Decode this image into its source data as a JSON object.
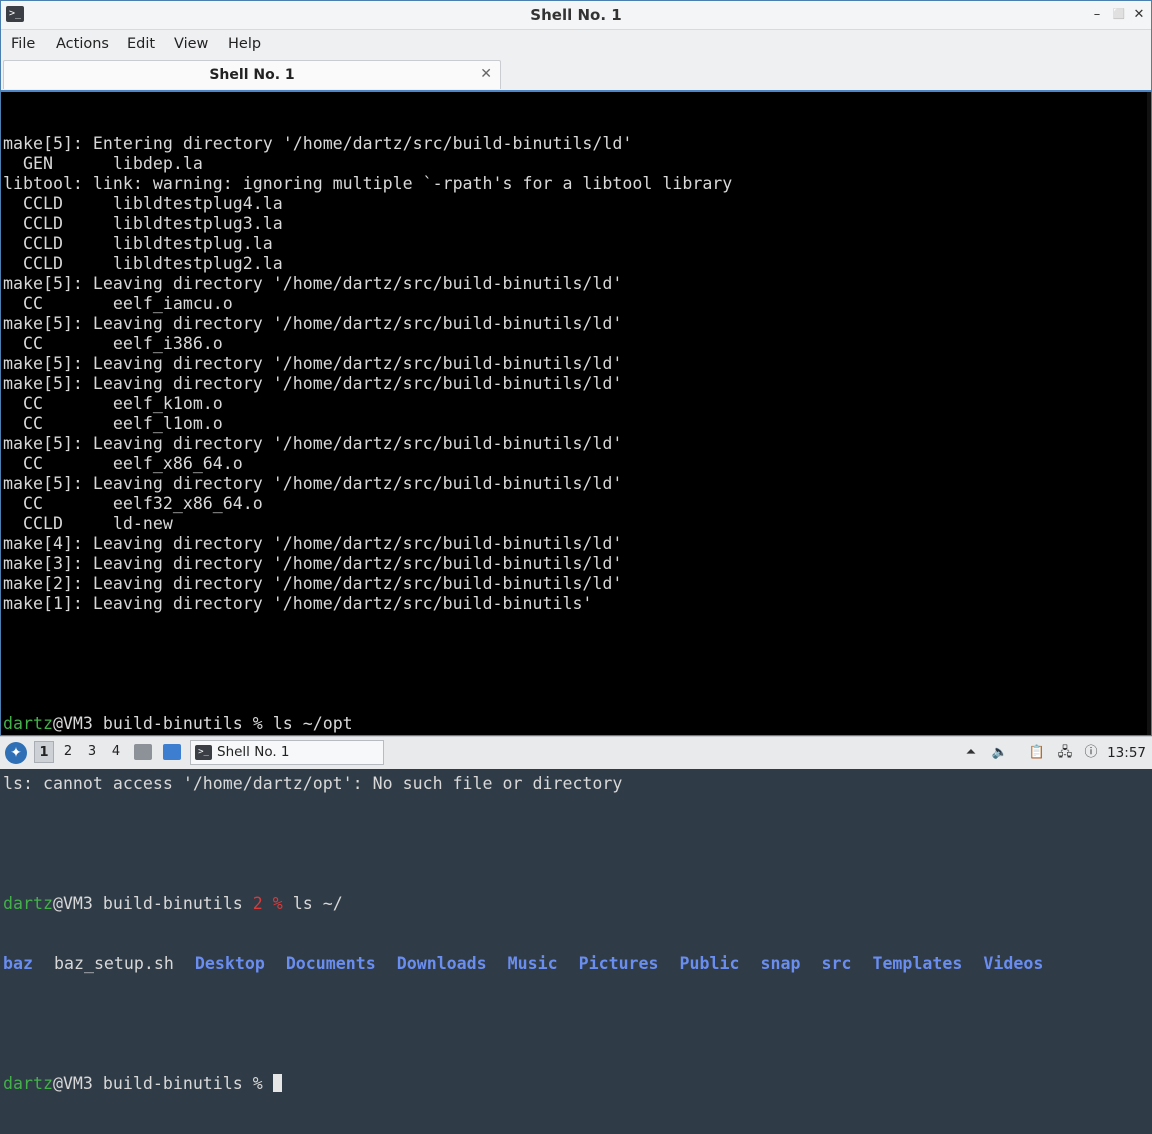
{
  "window": {
    "title": "Shell No. 1",
    "controls": {
      "minimize": "–",
      "maximize": "⬜",
      "close": "✕"
    }
  },
  "menu": [
    "File",
    "Actions",
    "Edit",
    "View",
    "Help"
  ],
  "tab": {
    "label": "Shell No. 1",
    "close": "✕"
  },
  "terminal": {
    "lines": [
      "make[5]: Entering directory '/home/dartz/src/build-binutils/ld'",
      "  GEN      libdep.la",
      "libtool: link: warning: ignoring multiple `-rpath's for a libtool library",
      "  CCLD     libldtestplug4.la",
      "  CCLD     libldtestplug3.la",
      "  CCLD     libldtestplug.la",
      "  CCLD     libldtestplug2.la",
      "make[5]: Leaving directory '/home/dartz/src/build-binutils/ld'",
      "  CC       eelf_iamcu.o",
      "make[5]: Leaving directory '/home/dartz/src/build-binutils/ld'",
      "  CC       eelf_i386.o",
      "make[5]: Leaving directory '/home/dartz/src/build-binutils/ld'",
      "make[5]: Leaving directory '/home/dartz/src/build-binutils/ld'",
      "  CC       eelf_k1om.o",
      "  CC       eelf_l1om.o",
      "make[5]: Leaving directory '/home/dartz/src/build-binutils/ld'",
      "  CC       eelf_x86_64.o",
      "make[5]: Leaving directory '/home/dartz/src/build-binutils/ld'",
      "  CC       eelf32_x86_64.o",
      "  CCLD     ld-new",
      "make[4]: Leaving directory '/home/dartz/src/build-binutils/ld'",
      "make[3]: Leaving directory '/home/dartz/src/build-binutils/ld'",
      "make[2]: Leaving directory '/home/dartz/src/build-binutils/ld'",
      "make[1]: Leaving directory '/home/dartz/src/build-binutils'"
    ],
    "prompt1": {
      "user": "dartz",
      "host": "@VM3 build-binutils % ",
      "command": "ls ~/opt"
    },
    "error": "ls: cannot access '/home/dartz/opt': No such file or directory",
    "prompt2": {
      "user": "dartz",
      "host": "@VM3 build-binutils ",
      "status": "2 % ",
      "command": "ls ~/"
    },
    "ls_output": [
      {
        "name": "baz",
        "dir": true
      },
      {
        "name": "baz_setup.sh",
        "dir": false
      },
      {
        "name": "Desktop",
        "dir": true
      },
      {
        "name": "Documents",
        "dir": true
      },
      {
        "name": "Downloads",
        "dir": true
      },
      {
        "name": "Music",
        "dir": true
      },
      {
        "name": "Pictures",
        "dir": true
      },
      {
        "name": "Public",
        "dir": true
      },
      {
        "name": "snap",
        "dir": true
      },
      {
        "name": "src",
        "dir": true
      },
      {
        "name": "Templates",
        "dir": true
      },
      {
        "name": "Videos",
        "dir": true
      }
    ],
    "prompt3": {
      "user": "dartz",
      "host": "@VM3 build-binutils % "
    }
  },
  "taskbar": {
    "workspaces": [
      "1",
      "2",
      "3",
      "4"
    ],
    "active_workspace": "1",
    "task_label": "Shell No. 1",
    "clock": "13:57",
    "colors": {
      "accent": "#4d86c7",
      "user": "#43b04a",
      "dir": "#6a8df0",
      "error_status": "#d83a3a"
    }
  }
}
